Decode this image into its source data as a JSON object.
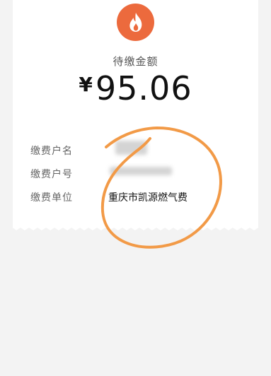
{
  "logo": {
    "icon": "flame-icon",
    "color": "#ec6a3d"
  },
  "amount": {
    "label": "待缴金额",
    "currency": "¥",
    "value": "95.06"
  },
  "details": [
    {
      "label": "缴费户名",
      "value": ""
    },
    {
      "label": "缴费户号",
      "value": ""
    },
    {
      "label": "缴费单位",
      "value": "重庆市凯源燃气费"
    }
  ],
  "annotation": {
    "color": "#f29a47"
  }
}
